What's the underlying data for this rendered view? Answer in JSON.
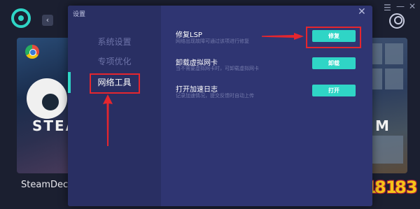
{
  "app": {
    "back_glyph": "‹",
    "window_controls": {
      "menu": "☰",
      "minimize": "—",
      "close": "✕"
    },
    "game_name": "SteamDeck-S",
    "left_card_text": "STEA",
    "right_card_text": "M",
    "accent_color": "#2fd5c6"
  },
  "watermark": {
    "text": "18183"
  },
  "modal": {
    "title": "设置",
    "close_glyph": "✕",
    "nav": [
      {
        "label": "系统设置",
        "active": false
      },
      {
        "label": "专项优化",
        "active": false
      },
      {
        "label": "网络工具",
        "active": true
      }
    ],
    "settings": [
      {
        "title": "修复LSP",
        "desc": "网络出现故障可通过该项进行修复",
        "button": "修复"
      },
      {
        "title": "卸载虚拟网卡",
        "desc": "当不需要虚拟网卡时，可卸载虚拟网卡",
        "button": "卸载"
      },
      {
        "title": "打开加速日志",
        "desc": "记录加速情况，提交反馈时自动上传",
        "button": "打开"
      }
    ]
  },
  "annotation": {
    "highlight_color": "#e5262e"
  }
}
